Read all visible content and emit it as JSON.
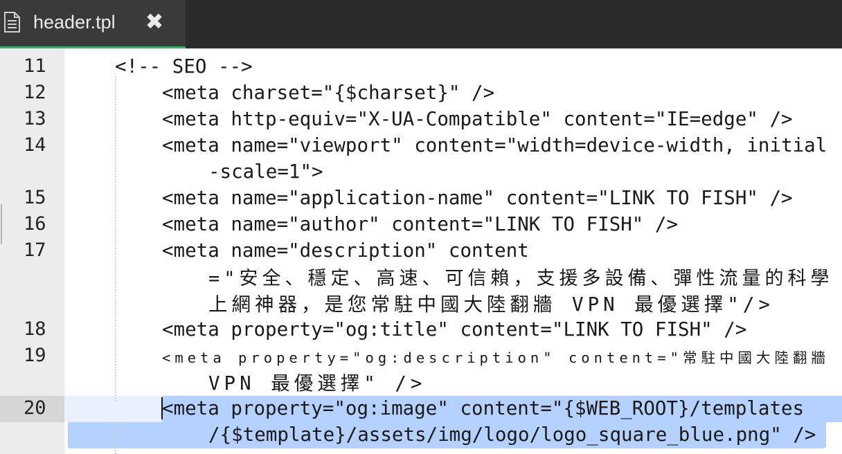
{
  "tab": {
    "file_icon": "document-icon",
    "title": "header.tpl",
    "close_glyph": "✖",
    "accent_color": "#2fb36b"
  },
  "editor": {
    "active_line": "20",
    "gutter": [
      "11",
      "12",
      "13",
      "14",
      "15",
      "16",
      "17",
      "18",
      "19",
      "20"
    ],
    "lines": {
      "l11": "<!-- SEO -->",
      "l12": "<meta charset=\"{$charset}\" />",
      "l13": "<meta http-equiv=\"X-UA-Compatible\" content=\"IE=edge\" />",
      "l14a": "<meta name=\"viewport\" content=\"width=device-width, initial",
      "l14b": "-scale=1\">",
      "l15": "<meta name=\"application-name\" content=\"LINK TO FISH\" />",
      "l16": "<meta name=\"author\" content=\"LINK TO FISH\" />",
      "l17a": "<meta name=\"description\" content",
      "l17b": "=\"安全、穩定、高速、可信賴，支援多設備、彈性流量的科學",
      "l17c": "上網神器，是您常駐中國大陸翻牆 VPN 最優選擇\"/>",
      "l18": "<meta property=\"og:title\" content=\"LINK TO FISH\" />",
      "l19a": "<meta property=\"og:description\" content=\"常駐中國大陸翻牆",
      "l19b": "VPN 最優選擇\" />",
      "l20a": "<meta property=\"og:image\" content=\"{$WEB_ROOT}/templates",
      "l20b": "/{$template}/assets/img/logo/logo_square_blue.png\" />"
    }
  },
  "colors": {
    "selection": "#b4d1ff",
    "gutter_bg": "#ececec",
    "tab_bg": "#3a3a3a"
  }
}
